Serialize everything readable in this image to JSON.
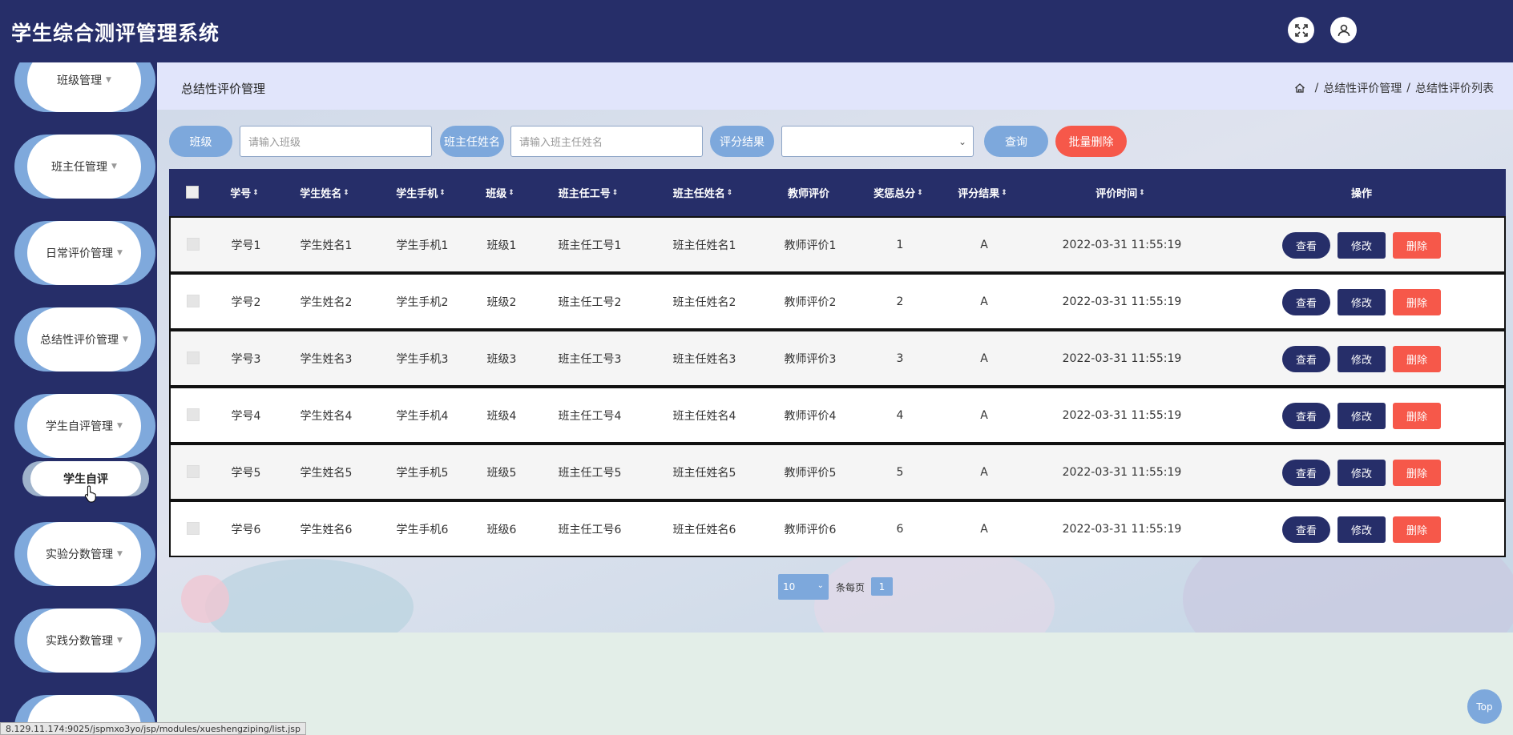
{
  "app": {
    "title": "学生综合测评管理系统"
  },
  "sidebar": {
    "items": [
      {
        "label": "班级管理"
      },
      {
        "label": "班主任管理"
      },
      {
        "label": "日常评价管理"
      },
      {
        "label": "总结性评价管理"
      },
      {
        "label": "学生自评管理"
      },
      {
        "label": "实验分数管理"
      },
      {
        "label": "实践分数管理"
      }
    ],
    "active_sub": "学生自评"
  },
  "page": {
    "title": "总结性评价管理",
    "breadcrumb": [
      "总结性评价管理",
      "总结性评价列表"
    ]
  },
  "search": {
    "class_label": "班级",
    "class_placeholder": "请输入班级",
    "teacher_label": "班主任姓名",
    "teacher_placeholder": "请输入班主任姓名",
    "result_label": "评分结果",
    "result_value": "",
    "query_label": "查询",
    "batch_delete_label": "批量删除"
  },
  "table": {
    "headers": [
      "学号",
      "学生姓名",
      "学生手机",
      "班级",
      "班主任工号",
      "班主任姓名",
      "教师评价",
      "奖惩总分",
      "评分结果",
      "评价时间",
      "操作"
    ],
    "rows": [
      [
        "学号1",
        "学生姓名1",
        "学生手机1",
        "班级1",
        "班主任工号1",
        "班主任姓名1",
        "教师评价1",
        "1",
        "A",
        "2022-03-31 11:55:19"
      ],
      [
        "学号2",
        "学生姓名2",
        "学生手机2",
        "班级2",
        "班主任工号2",
        "班主任姓名2",
        "教师评价2",
        "2",
        "A",
        "2022-03-31 11:55:19"
      ],
      [
        "学号3",
        "学生姓名3",
        "学生手机3",
        "班级3",
        "班主任工号3",
        "班主任姓名3",
        "教师评价3",
        "3",
        "A",
        "2022-03-31 11:55:19"
      ],
      [
        "学号4",
        "学生姓名4",
        "学生手机4",
        "班级4",
        "班主任工号4",
        "班主任姓名4",
        "教师评价4",
        "4",
        "A",
        "2022-03-31 11:55:19"
      ],
      [
        "学号5",
        "学生姓名5",
        "学生手机5",
        "班级5",
        "班主任工号5",
        "班主任姓名5",
        "教师评价5",
        "5",
        "A",
        "2022-03-31 11:55:19"
      ],
      [
        "学号6",
        "学生姓名6",
        "学生手机6",
        "班级6",
        "班主任工号6",
        "班主任姓名6",
        "教师评价6",
        "6",
        "A",
        "2022-03-31 11:55:19"
      ]
    ],
    "actions": {
      "view": "查看",
      "edit": "修改",
      "delete": "删除"
    }
  },
  "pagination": {
    "page_size": "10",
    "per_page_label": "条每页",
    "current_page": "1"
  },
  "status_url": "8.129.11.174:9025/jspmxo3yo/jsp/modules/xueshengziping/list.jsp",
  "top_label": "Top",
  "colors": {
    "primary": "#262e69",
    "accent": "#7da8dc",
    "danger": "#f6584a"
  }
}
